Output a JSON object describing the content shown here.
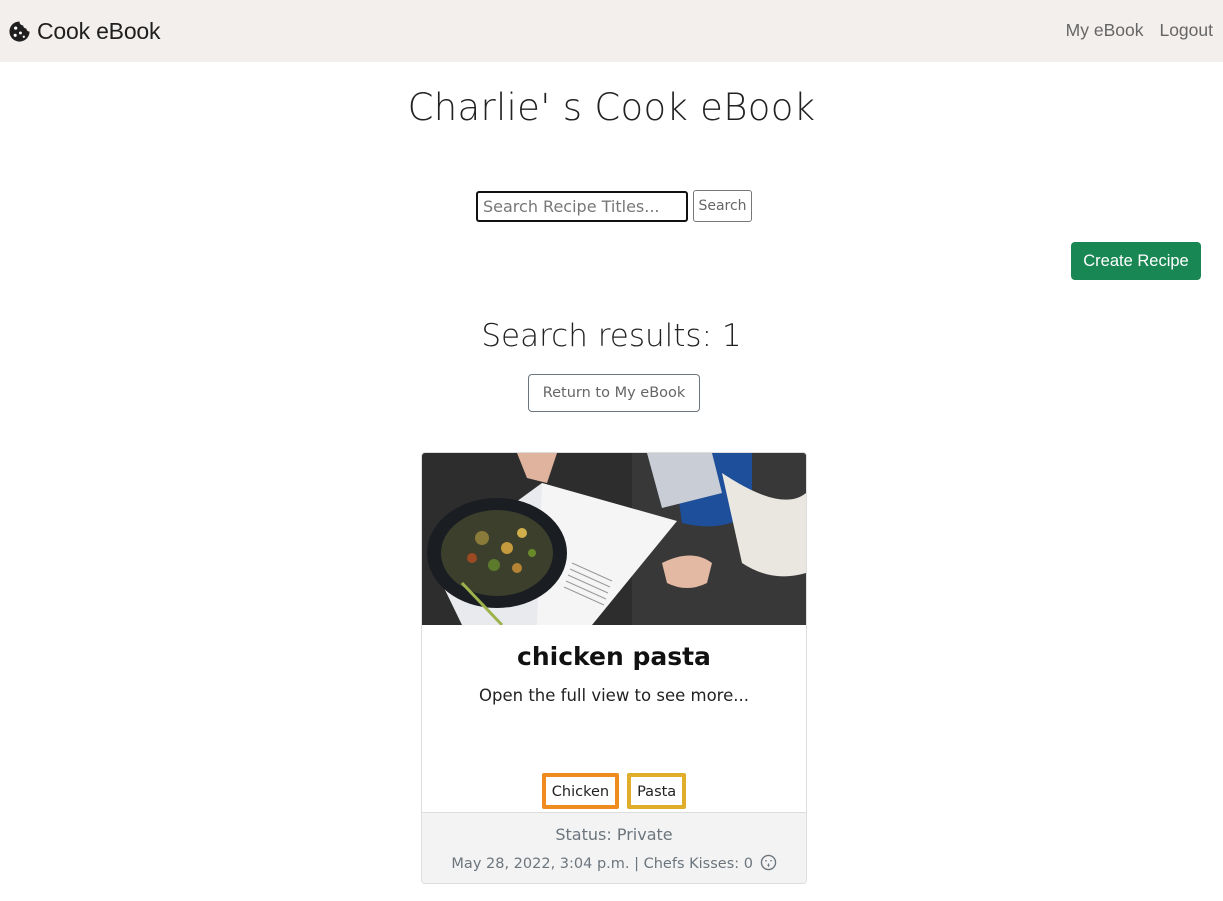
{
  "navbar": {
    "brand": "Cook eBook",
    "brand_icon": "cookie-icon",
    "links": [
      "My eBook",
      "Logout"
    ]
  },
  "page": {
    "title": "Charlie' s Cook eBook"
  },
  "search": {
    "placeholder": "Search Recipe Titles...",
    "value": "",
    "button": "Search"
  },
  "actions": {
    "create_recipe": "Create Recipe",
    "return": "Return to My eBook"
  },
  "results": {
    "label": "Search results:",
    "count": "1"
  },
  "recipe": {
    "title": "chicken pasta",
    "excerpt": "Open the full view to see more...",
    "tags": [
      {
        "label": "Chicken",
        "color": "#f08c1e"
      },
      {
        "label": "Pasta",
        "color": "#e0ae2a"
      }
    ],
    "status": "Status: Private",
    "date": "May 28, 2022, 3:04 p.m.",
    "kisses": "| Chefs Kisses: 0",
    "kiss_icon": "kiss-face-icon"
  },
  "colors": {
    "navbar_bg": "#f2efed",
    "primary_green": "#198754",
    "muted_text": "#6c757d",
    "footer_bg": "#f3f3f3"
  }
}
